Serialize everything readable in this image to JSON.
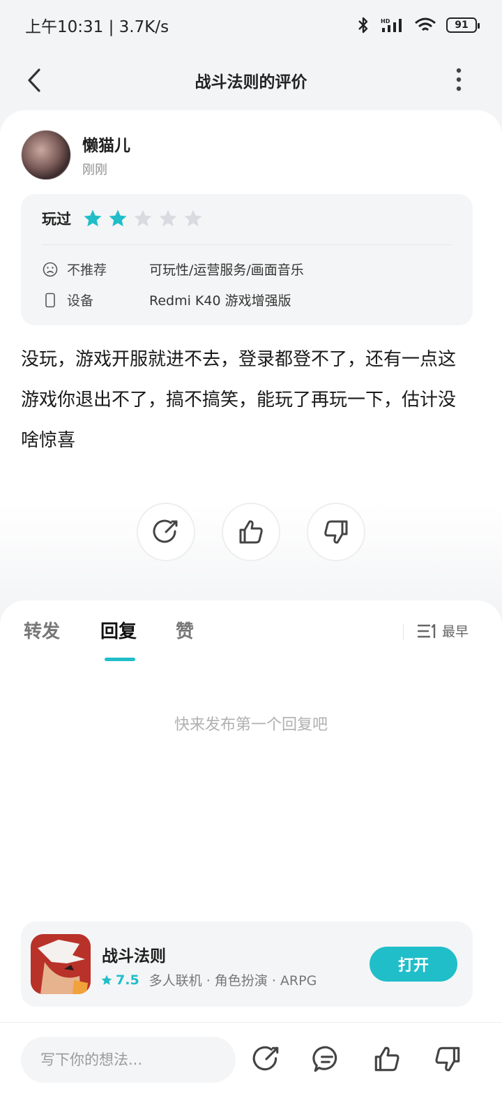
{
  "status_bar": {
    "time_speed": "上午10:31 | 3.7K/s",
    "battery": "91"
  },
  "nav": {
    "title": "战斗法则的评价"
  },
  "review": {
    "user_name": "懒猫儿",
    "time": "刚刚",
    "played_label": "玩过",
    "stars_filled": 2,
    "stars_total": 5,
    "recommend_label": "不推荐",
    "recommend_value": "可玩性/运营服务/画面音乐",
    "device_label": "设备",
    "device_value": "Redmi K40 游戏增强版",
    "text": "没玩，游戏开服就进不去，登录都登不了，还有一点这游戏你退出不了，搞不搞笑，能玩了再玩一下，估计没啥惊喜"
  },
  "tabs": {
    "forward": "转发",
    "reply": "回复",
    "like": "赞",
    "sort": "最早",
    "empty": "快来发布第一个回复吧"
  },
  "app": {
    "name": "战斗法则",
    "score": "7.5",
    "tags": "多人联机 · 角色扮演 · ARPG",
    "open_label": "打开"
  },
  "bottom": {
    "placeholder": "写下你的想法..."
  },
  "colors": {
    "accent": "#1fbec9",
    "star_empty": "#d8dbe0"
  }
}
